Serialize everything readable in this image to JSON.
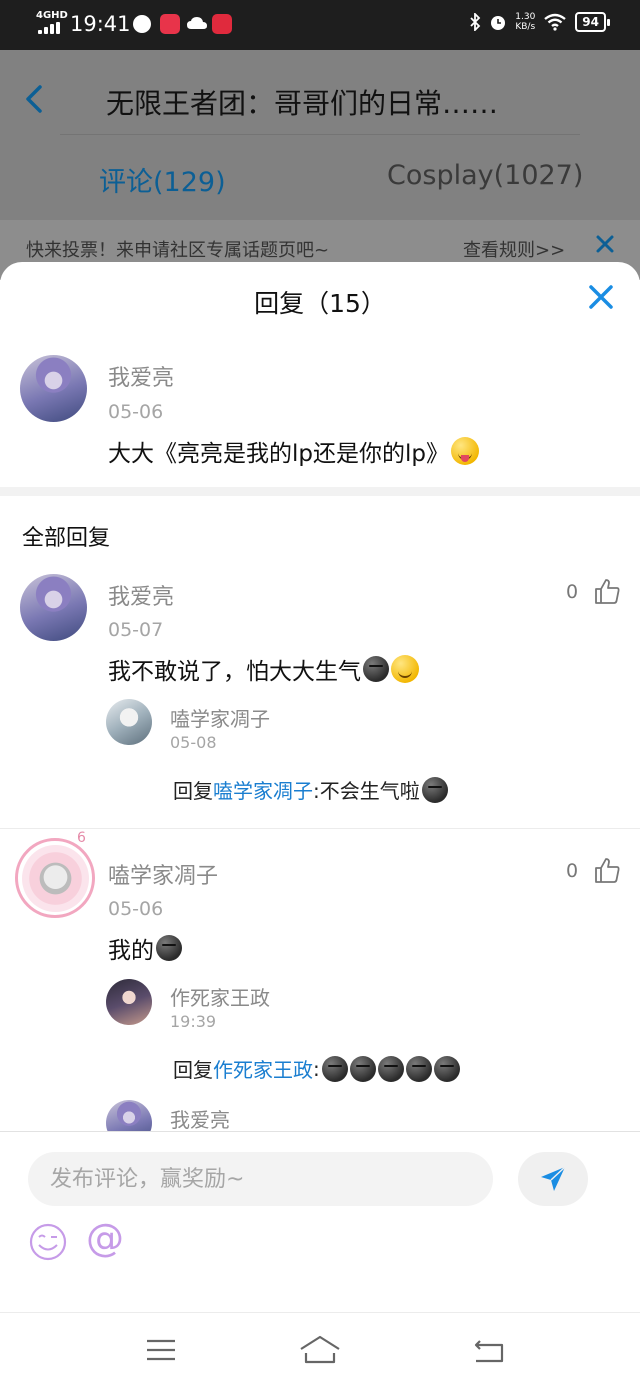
{
  "status_bar": {
    "network": "4GHD",
    "time": "19:41",
    "speed_value": "1.30",
    "speed_unit": "KB/s",
    "battery": "94"
  },
  "header": {
    "title": "无限王者团：哥哥们的日常……",
    "tabs": [
      {
        "label": "评论(129)",
        "active": true
      },
      {
        "label": "Cosplay(1027)",
        "active": false
      }
    ],
    "accent_color": "#1a7ed0"
  },
  "notice": {
    "text": "快来投票！来申请社区专属话题页吧~",
    "link": "查看规则>>"
  },
  "sheet": {
    "title": "回复（15）",
    "original": {
      "username": "我爱亮",
      "date": "05-06",
      "text": "大大《亮亮是我的lp还是你的lp》"
    },
    "section_title": "全部回复",
    "replies": [
      {
        "username": "我爱亮",
        "date": "05-07",
        "text": "我不敢说了，怕大大生气",
        "likes": "0",
        "sub": {
          "username": "嗑学家凋子",
          "date": "05-08",
          "prefix": "回复",
          "target": "嗑学家凋子",
          "text": ":不会生气啦"
        }
      },
      {
        "username": "嗑学家凋子",
        "date": "05-06",
        "text": "我的",
        "likes": "0",
        "badge": "6",
        "sub": {
          "username": "作死家王政",
          "date": "19:39",
          "prefix": "回复",
          "target": "作死家王政",
          "text": ":"
        },
        "sub2": {
          "username": "我爱亮"
        }
      }
    ]
  },
  "composer": {
    "placeholder": "发布评论，赢奖励~",
    "at_symbol": "@"
  }
}
